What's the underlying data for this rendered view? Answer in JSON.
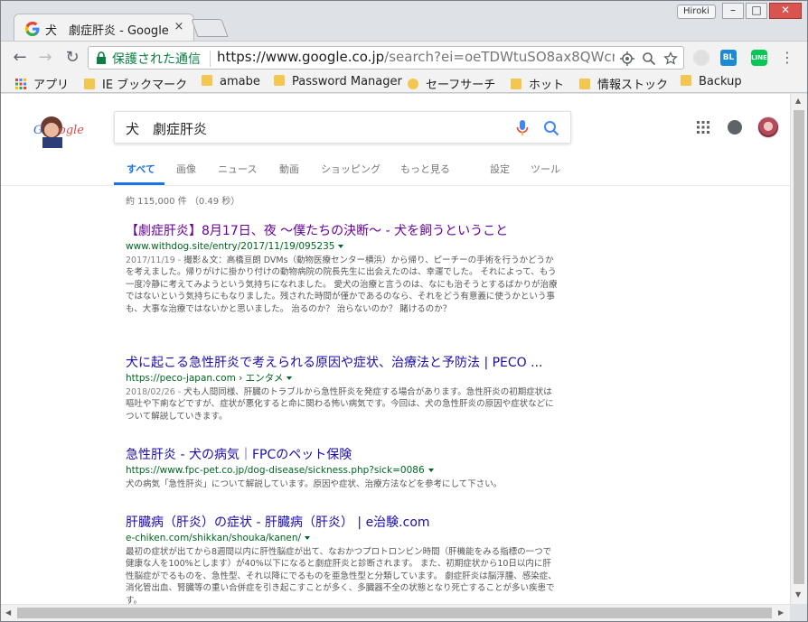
{
  "browser": {
    "tab_title": "犬　劇症肝炎 - Google",
    "tab_close": "×",
    "profile_name": "Hiroki",
    "window_min": "–",
    "window_max": "□",
    "window_close": "✕",
    "secure_label": "保護された通信",
    "url_host": "https://www.google.co.jp",
    "url_path": "/search?ei=oeTDWtuSO8ax8QWcm…",
    "bookmarks": [
      {
        "label": "アプリ"
      },
      {
        "label": "IE ブックマーク"
      },
      {
        "label": "amabe"
      },
      {
        "label": "Password Manager"
      },
      {
        "label": "セーフサーチ"
      },
      {
        "label": "ホット"
      },
      {
        "label": "情報ストック"
      },
      {
        "label": "Backup"
      }
    ],
    "ext_bl": "BL",
    "ext_line": "LINE"
  },
  "search": {
    "query": "犬　劇症肝炎",
    "tabs": {
      "all": "すべて",
      "images": "画像",
      "news": "ニュース",
      "videos": "動画",
      "shopping": "ショッピング",
      "more": "もっと見る",
      "settings": "設定",
      "tools": "ツール"
    },
    "stats": "約 115,000 件 （0.49 秒）",
    "results": [
      {
        "title": "【劇症肝炎】8月17日、夜 ～僕たちの決断～ - 犬を飼うということ",
        "url": "www.withdog.site/entry/2017/11/19/095235",
        "date": "2017/11/19 - ",
        "snippet": "撮影＆文：高橋亘朗 DVMs（動物医療センター横浜）から帰り、ピーチーの手術を行うかどうかを考えました。帰りがけに掛かり付けの動物病院の院長先生に出会えたのは、幸運でした。 それによって、もう一度冷静に考えてみようという気持ちになれました。 愛犬の治療と言うのは、なにも治そうとするばかりが治療ではないという気持ちにもなりました。残された時間が僅かであるのなら、それをどう有意義に使うかという事も、大事な治療ではないかと思いました。 治るのか？ 治らないのか？ 賭けるのか？"
      },
      {
        "title": "犬に起こる急性肝炎で考えられる原因や症状、治療法と予防法 | PECO ...",
        "url": "https://peco-japan.com › エンタメ",
        "date": "2018/02/26 - ",
        "snippet": "犬も人間同様、肝臓のトラブルから急性肝炎を発症する場合があります。急性肝炎の初期症状は嘔吐や下痢などですが、症状が悪化すると命に関わる怖い病気です。今回は、犬の急性肝炎の原因や症状などについて解説していきます。"
      },
      {
        "title": "急性肝炎 - 犬の病気｜FPCのペット保険",
        "url": "https://www.fpc-pet.co.jp/dog-disease/sickness.php?sick=0086",
        "date": "",
        "snippet": "犬の病気「急性肝炎」について解説しています。原因や症状、治療方法などを参考にして下さい。"
      },
      {
        "title": "肝臓病（肝炎）の症状 - 肝臓病（肝炎） | e治験.com",
        "url": "e-chiken.com/shikkan/shouka/kanen/",
        "date": "",
        "snippet": "最初の症状が出てから8週間以内に肝性脳症が出て、なおかつプロトロンビン時間（肝機能をみる指標の一つで健康な人を100%とします）が40%以下になると劇症肝炎と診断されます。 また、初期症状から10日以内に肝性脳症がでるものを、急性型、それ以降にでるものを亜急性型と分類しています。 劇症肝炎は脳浮腫、感染症、消化管出血、腎臓等の重い合併症を引き起こすことが多く、多臓器不全の状態となり死亡することが多い疾患です。"
      }
    ]
  },
  "colors": {
    "visited_link": "#660099",
    "link": "#1a0dab",
    "url_green": "#006621",
    "secure_green": "#0b8043",
    "accent_blue": "#1a73e8"
  }
}
